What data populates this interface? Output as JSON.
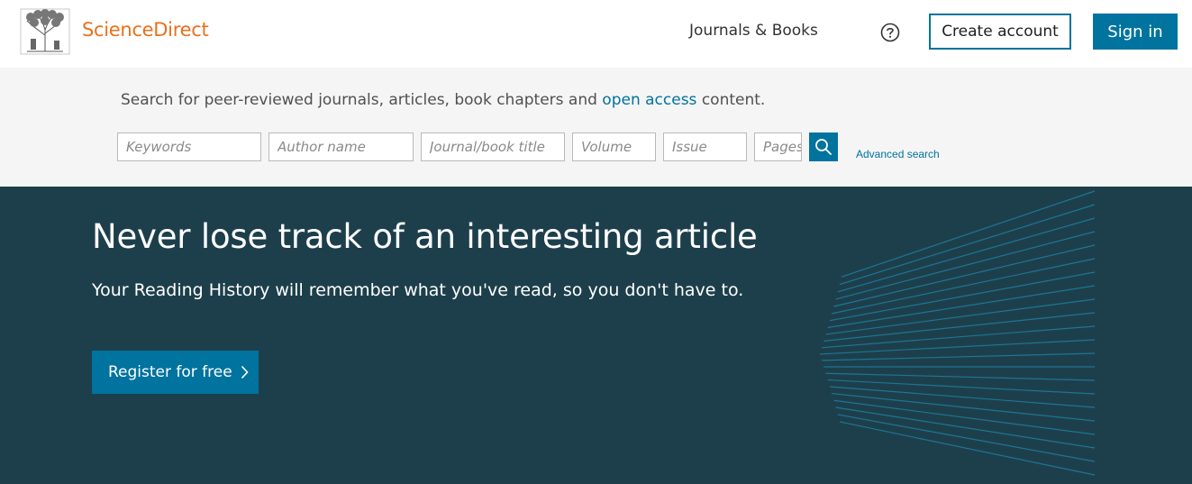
{
  "header": {
    "brand": "ScienceDirect",
    "nav_journals": "Journals & Books",
    "create_account": "Create account",
    "sign_in": "Sign in"
  },
  "search": {
    "intro_before": "Search for peer-reviewed journals, articles, book chapters and ",
    "intro_link": "open access",
    "intro_after": " content.",
    "fields": {
      "keywords": "Keywords",
      "author": "Author name",
      "journal": "Journal/book title",
      "volume": "Volume",
      "issue": "Issue",
      "pages": "Pages"
    },
    "advanced": "Advanced search"
  },
  "hero": {
    "title": "Never lose track of an interesting article",
    "subtitle": "Your Reading History will remember what you've read, so you don't have to.",
    "register": "Register for free"
  },
  "colors": {
    "brand_orange": "#e9711c",
    "primary_blue": "#00739e",
    "hero_bg": "#1d3f4c",
    "search_bg": "#f5f5f5"
  }
}
